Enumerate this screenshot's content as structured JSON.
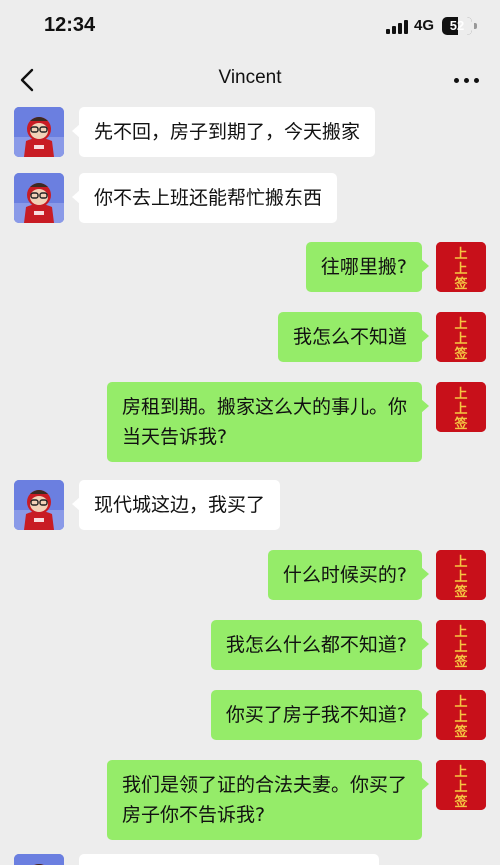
{
  "status_bar": {
    "time": "12:34",
    "network": "4G",
    "battery": "52",
    "battery_level_percent": 52
  },
  "header": {
    "title": "Vincent",
    "back_icon": "chevron-left-icon",
    "more_icon": "ellipsis-icon"
  },
  "colors": {
    "background": "#ededed",
    "sent_bubble": "#95ec69",
    "received_bubble": "#ffffff",
    "self_avatar": "#c8101a"
  },
  "self_avatar_text": "上上签",
  "messages": [
    {
      "from": "other",
      "text": "先不回，房子到期了，今天搬家"
    },
    {
      "from": "other",
      "text": "你不去上班还能帮忙搬东西"
    },
    {
      "from": "me",
      "text": "往哪里搬?"
    },
    {
      "from": "me",
      "text": "我怎么不知道"
    },
    {
      "from": "me",
      "text": "房租到期。搬家这么大的事儿。你\n当天告诉我?"
    },
    {
      "from": "other",
      "text": "现代城这边，我买了"
    },
    {
      "from": "me",
      "text": "什么时候买的?"
    },
    {
      "from": "me",
      "text": "我怎么什么都不知道?"
    },
    {
      "from": "me",
      "text": "你买了房子我不知道?"
    },
    {
      "from": "me",
      "text": "我们是领了证的合法夫妻。你买了\n房子你不告诉我?"
    }
  ]
}
